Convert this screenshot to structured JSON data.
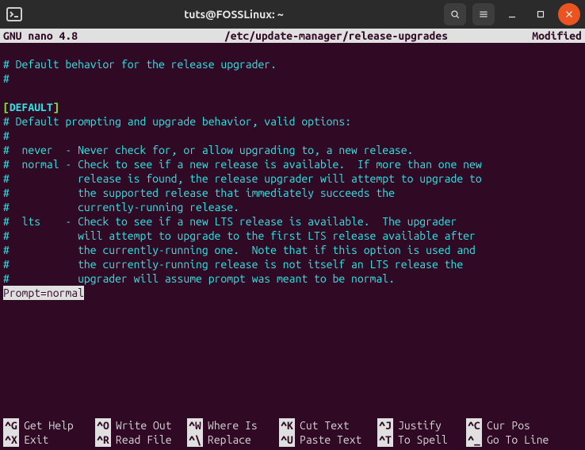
{
  "titlebar": {
    "title": "tuts@FOSSLinux: ~"
  },
  "nano": {
    "app": " GNU nano 4.8",
    "file": "/etc/update-manager/release-upgrades",
    "modified": "Modified "
  },
  "content": {
    "l0": "# Default behavior for the release upgrader.",
    "l1": "#",
    "section_open": "[",
    "section_name": "DEFAULT",
    "section_close": "]",
    "l3": "# Default prompting and upgrade behavior, valid options:",
    "l4": "#",
    "l5": "#  never  - Never check for, or allow upgrading to, a new release.",
    "l6": "#  normal - Check to see if a new release is available.  If more than one new",
    "l7": "#           release is found, the release upgrader will attempt to upgrade to",
    "l8": "#           the supported release that immediately succeeds the",
    "l9": "#           currently-running release.",
    "l10": "#  lts    - Check to see if a new LTS release is available.  The upgrader",
    "l11": "#           will attempt to upgrade to the first LTS release available after",
    "l12": "#           the currently-running one.  Note that if this option is used and",
    "l13": "#           the currently-running release is not itself an LTS release the",
    "l14": "#           upgrader will assume prompt was meant to be normal.",
    "prompt": "Prompt=normal"
  },
  "shortcuts": {
    "r0c0k": "^G",
    "r0c0t": "Get Help",
    "r0c1k": "^O",
    "r0c1t": "Write Out",
    "r0c2k": "^W",
    "r0c2t": "Where Is",
    "r0c3k": "^K",
    "r0c3t": "Cut Text",
    "r0c4k": "^J",
    "r0c4t": "Justify",
    "r0c5k": "^C",
    "r0c5t": "Cur Pos",
    "r1c0k": "^X",
    "r1c0t": "Exit",
    "r1c1k": "^R",
    "r1c1t": "Read File",
    "r1c2k": "^\\",
    "r1c2t": "Replace",
    "r1c3k": "^U",
    "r1c3t": "Paste Text",
    "r1c4k": "^T",
    "r1c4t": "To Spell",
    "r1c5k": "^_",
    "r1c5t": "Go To Line"
  }
}
